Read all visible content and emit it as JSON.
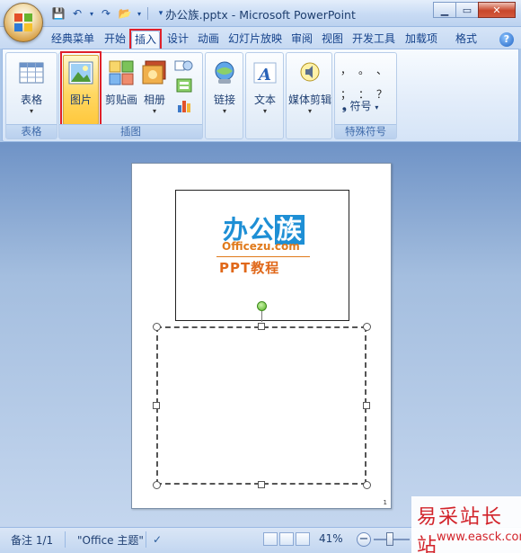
{
  "window": {
    "title": "办公族.pptx - Microsoft PowerPoint",
    "minimize": "▁",
    "maximize": "▭",
    "close": "✕"
  },
  "tabs": [
    {
      "label": "经典菜单"
    },
    {
      "label": "开始"
    },
    {
      "label": "插入"
    },
    {
      "label": "设计"
    },
    {
      "label": "动画"
    },
    {
      "label": "幻灯片放映"
    },
    {
      "label": "审阅"
    },
    {
      "label": "视图"
    },
    {
      "label": "开发工具"
    },
    {
      "label": "加载项"
    },
    {
      "label": "格式"
    }
  ],
  "ribbon": {
    "groups": {
      "table": {
        "label": "表格",
        "button": "表格"
      },
      "illustrations": {
        "label": "插图",
        "picture": "图片",
        "clipart": "剪贴画",
        "album": "相册"
      },
      "links": {
        "button": "链接"
      },
      "text": {
        "button": "文本"
      },
      "media": {
        "button": "媒体剪辑"
      },
      "symbols": {
        "label": "特殊符号",
        "chars": [
          "，",
          "。",
          "、",
          "；",
          "：",
          "？"
        ],
        "button": "符号"
      }
    }
  },
  "slide": {
    "logo_main": "办公",
    "logo_z": "族",
    "logo_sub": "Officezu.com",
    "logo_ppt": "PPT教程",
    "page_number": "1"
  },
  "status": {
    "slide_info": "备注 1/1",
    "theme": "\"Office 主题\"",
    "zoom": "41%"
  },
  "watermark": {
    "cn": "易采站长站",
    "en": "www.easck.com"
  }
}
